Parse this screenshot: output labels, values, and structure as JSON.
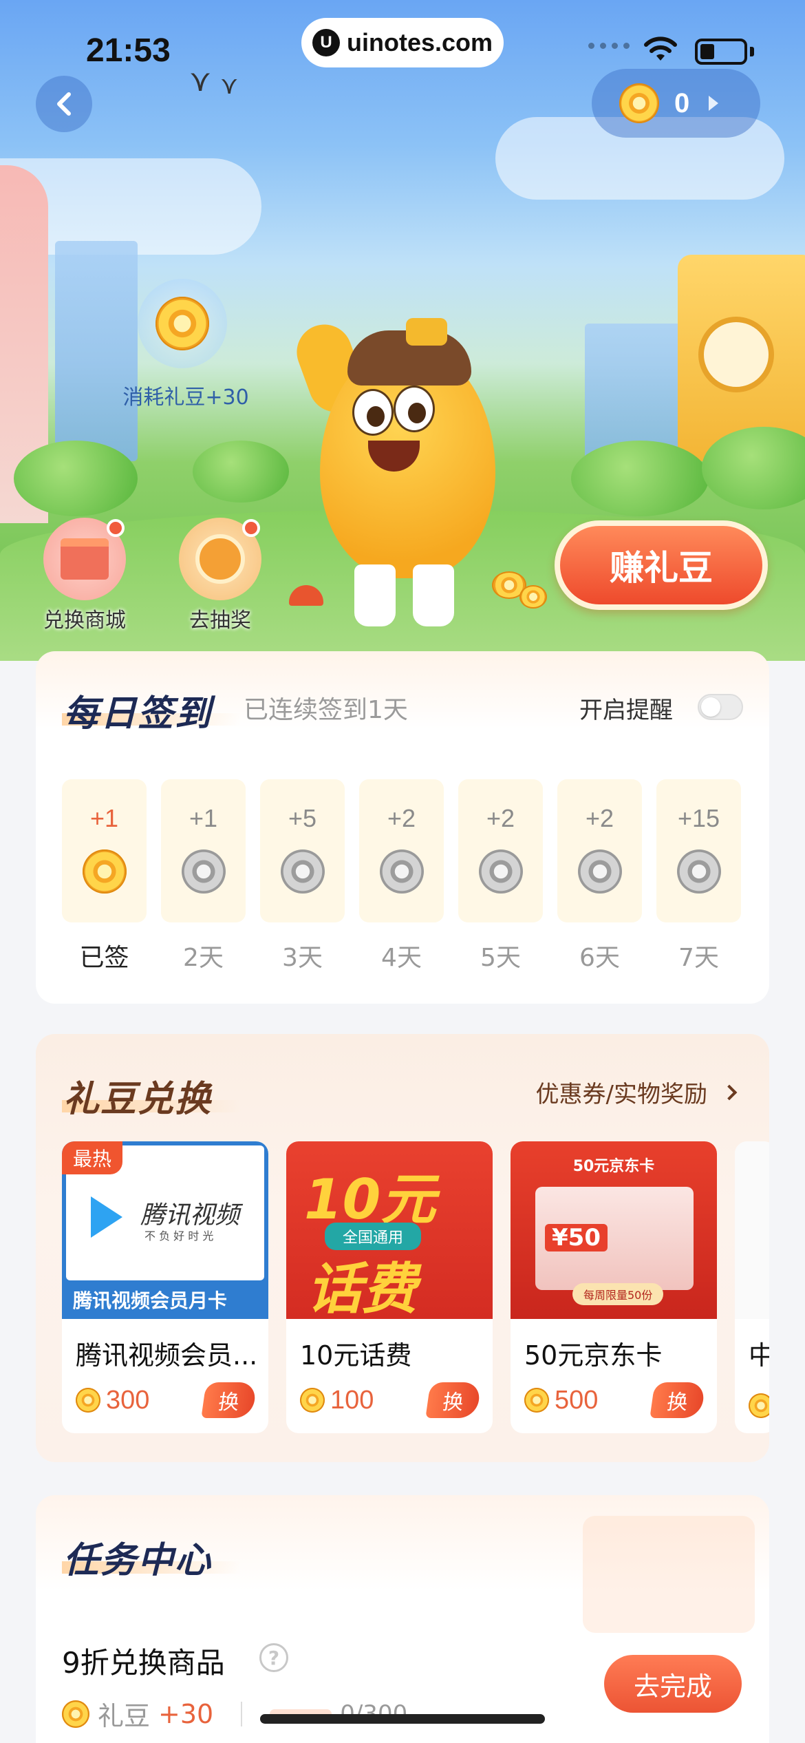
{
  "status_bar": {
    "time": "21:53",
    "url": "uinotes.com"
  },
  "header": {
    "coin_balance": "0"
  },
  "hero": {
    "bubble_label": "消耗礼豆+30",
    "shortcuts": [
      {
        "label": "兑换商城"
      },
      {
        "label": "去抽奖"
      }
    ],
    "earn_button": "赚礼豆"
  },
  "daily_signin": {
    "title": "每日签到",
    "streak_text": "已连续签到1天",
    "reminder_label": "开启提醒",
    "days": [
      {
        "points": "+1",
        "label": "已签",
        "done": true
      },
      {
        "points": "+1",
        "label": "2天",
        "done": false
      },
      {
        "points": "+5",
        "label": "3天",
        "done": false
      },
      {
        "points": "+2",
        "label": "4天",
        "done": false
      },
      {
        "points": "+2",
        "label": "5天",
        "done": false
      },
      {
        "points": "+2",
        "label": "6天",
        "done": false
      },
      {
        "points": "+15",
        "label": "7天",
        "done": false
      }
    ]
  },
  "exchange": {
    "title": "礼豆兑换",
    "link": "优惠券/实物奖励",
    "products": [
      {
        "name": "腾讯视频会员...",
        "price": "300",
        "button": "换",
        "tag": "最热",
        "image_brand": "腾讯视频",
        "image_slogan": "不 负 好 时 光",
        "image_caption": "腾讯视频会员月卡"
      },
      {
        "name": "10元话费",
        "price": "100",
        "button": "换",
        "image_line1": "10元",
        "image_badge": "全国通用",
        "image_line2": "话费"
      },
      {
        "name": "50元京东卡",
        "price": "500",
        "button": "换",
        "image_title": "50元京东卡",
        "image_amount": "¥50",
        "image_limit": "每周限量50份"
      },
      {
        "name": "中"
      }
    ]
  },
  "tasks": {
    "title": "任务中心",
    "items": [
      {
        "name": "9折兑换商品",
        "reward_label": "礼豆",
        "reward_value": "+30",
        "progress": "0/300",
        "button": "去完成"
      }
    ]
  },
  "colors": {
    "accent": "#ec5434",
    "title_navy": "#1d2a55",
    "coin_gold": "#f5a623"
  }
}
